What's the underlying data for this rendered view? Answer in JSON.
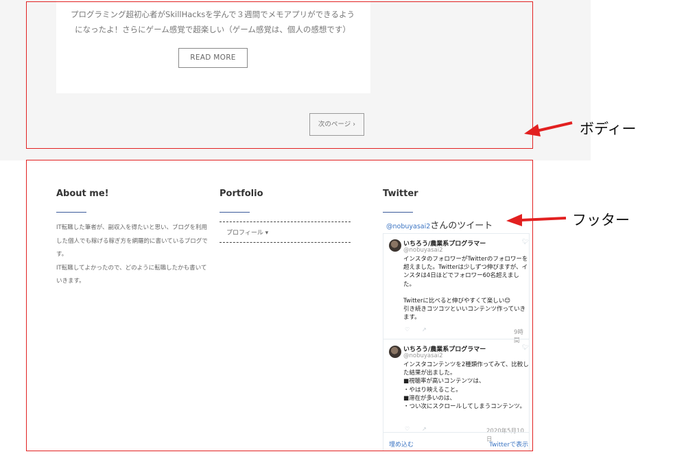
{
  "post": {
    "excerpt": "プログラミング超初心者がSkillHacksを学んで３週間でメモアプリができるようになったよ！さらにゲーム感覚で超楽しい（ゲーム感覚は、個人の感想です）",
    "read_more_label": "READ MORE"
  },
  "pagination": {
    "next_label": "次のページ ›"
  },
  "annotations": {
    "body_label": "ボディー",
    "footer_label": "フッター",
    "color": "#e22020"
  },
  "footer": {
    "about": {
      "heading": "About me!",
      "text": "IT転職した筆者が、副収入を得たいと思い、ブログを利用した個人でも稼げる稼ぎ方を網羅的に書いているブログです。\nIT転職してよかったので、どのように転職したかも書いていきます。"
    },
    "portfolio": {
      "heading": "Portfolio",
      "items": [
        {
          "label": "プロフィール ▾"
        }
      ]
    },
    "twitter": {
      "heading": "Twitter",
      "timeline_handle": "@nobuyasai2",
      "timeline_suffix": "さんのツイート",
      "tweets": [
        {
          "name": "いちろう/農業系プログラマー",
          "username": "@nobuyasai2",
          "text": "インスタのフォロワーがTwitterのフォロワーを超えました。Twitterは少しずつ伸びますが、インスタは4日ほどでフォロワー60名超えました。\n\nTwitterに比べると伸びやすくて楽しい😊\n引き続きコツコツといいコンテンツ作っていきます。",
          "time": "9時間"
        },
        {
          "name": "いちろう/農業系プログラマー",
          "username": "@nobuyasai2",
          "text": "インスタコンテンツを2種類作ってみて、比較した結果が出ました。\n■視聴率が高いコンテンツは、\n・やはり映えること。\n■滞在が多いのは、\n・つい次にスクロールしてしまうコンテンツ。",
          "time": "2020年5月10日"
        }
      ],
      "embed_label": "埋め込む",
      "view_label": "Twitterで表示"
    }
  }
}
